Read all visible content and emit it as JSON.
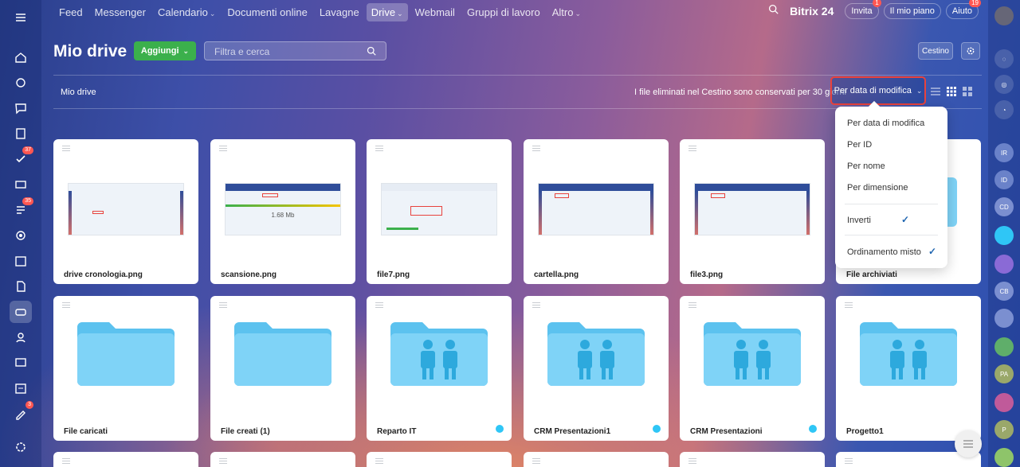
{
  "nav": {
    "items": [
      {
        "label": "Feed",
        "caret": false
      },
      {
        "label": "Messenger",
        "caret": false
      },
      {
        "label": "Calendario",
        "caret": true
      },
      {
        "label": "Documenti online",
        "caret": false
      },
      {
        "label": "Lavagne",
        "caret": false
      },
      {
        "label": "Drive",
        "caret": true,
        "active": true
      },
      {
        "label": "Webmail",
        "caret": false
      },
      {
        "label": "Gruppi di lavoro",
        "caret": false
      },
      {
        "label": "Altro",
        "caret": true
      }
    ],
    "brand": "Bitrix 24",
    "invite": "Invita",
    "invite_badge": "1",
    "plan": "Il mio piano",
    "help": "Aiuto",
    "help_badge": "19"
  },
  "header": {
    "title": "Mio drive",
    "add_button": "Aggiungi",
    "search_placeholder": "Filtra e cerca",
    "trash_button": "Cestino"
  },
  "toolbar": {
    "breadcrumb": "Mio drive",
    "info": "I file eliminati nel Cestino sono conservati per 30 giorni",
    "sort_label": "Per data di modifica"
  },
  "sort_menu": {
    "items": [
      "Per data di modifica",
      "Per ID",
      "Per nome",
      "Per dimensione"
    ],
    "invert": "Inverti",
    "mixed": "Ordinamento misto"
  },
  "files": [
    {
      "name": "drive cronologia.png"
    },
    {
      "name": "scansione.png",
      "thumb_text": "1.68 Mb"
    },
    {
      "name": "file7.png"
    },
    {
      "name": "cartella.png"
    },
    {
      "name": "file3.png"
    },
    {
      "name": "File archiviati"
    }
  ],
  "folders": [
    {
      "name": "File caricati",
      "shared": false
    },
    {
      "name": "File creati (1)",
      "shared": false
    },
    {
      "name": "Reparto IT",
      "shared": true
    },
    {
      "name": "CRM Presentazioni1",
      "shared": true
    },
    {
      "name": "CRM Presentazioni",
      "shared": true
    },
    {
      "name": "Progetto1",
      "shared": true
    }
  ],
  "leftbar_badges": {
    "tasks": "37",
    "feed": "35",
    "sign": "3"
  },
  "rightbar_initials": [
    "IR",
    "ID",
    "CD",
    "CB",
    "PA",
    "P"
  ],
  "colors": {
    "accent_green": "#3bb04c",
    "highlight_red": "#e8423d",
    "folder": "#7fd3f7",
    "folder_dark": "#5cc2ef",
    "check": "#2066b0"
  }
}
